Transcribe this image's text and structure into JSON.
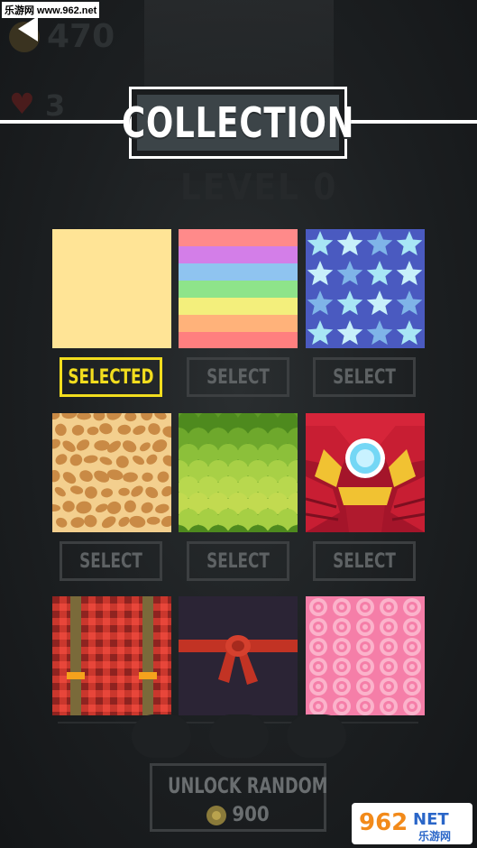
{
  "watermark": "乐游网 www.962.net",
  "hud": {
    "coins": "470",
    "lives": "3"
  },
  "background_text": "LEVEL 0",
  "title": "COLLECTION",
  "tiles": [
    {
      "name": "plain-yellow",
      "button": "SELECTED",
      "selected": true
    },
    {
      "name": "rainbow-stripes",
      "button": "SELECT",
      "selected": false
    },
    {
      "name": "stars",
      "button": "SELECT",
      "selected": false
    },
    {
      "name": "giraffe",
      "button": "SELECT",
      "selected": false
    },
    {
      "name": "green-scales",
      "button": "SELECT",
      "selected": false
    },
    {
      "name": "iron-armor",
      "button": "SELECT",
      "selected": false
    },
    {
      "name": "red-plaid-suspenders",
      "button": null,
      "selected": false
    },
    {
      "name": "red-belt",
      "button": null,
      "selected": false
    },
    {
      "name": "pink-circles",
      "button": null,
      "selected": false
    }
  ],
  "unlock": {
    "label": "UNLOCK RANDOM",
    "cost": "900"
  },
  "logo": {
    "number": "962",
    "suffix": "NET",
    "sub": "乐游网"
  },
  "colors": {
    "selected_accent": "#f2dd1e",
    "button_border": "#3c3f41"
  }
}
